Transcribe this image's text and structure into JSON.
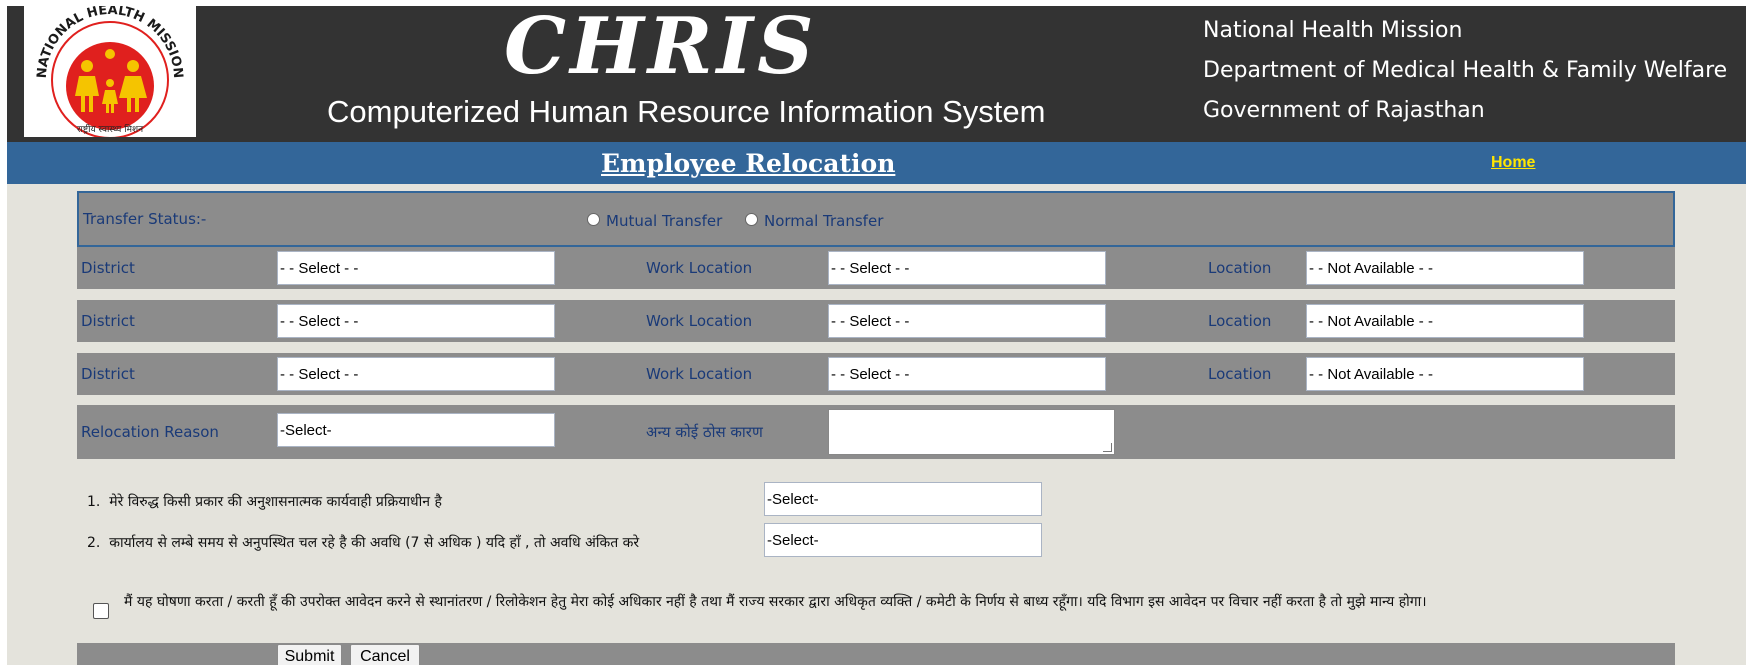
{
  "header": {
    "logo": {
      "arc_text": "NATIONAL HEALTH MISSION",
      "hindi_text": "राष्ट्रीय स्वास्थ्य मिशन",
      "colors": {
        "circle": "#e0201e",
        "figures": "#f5c400"
      }
    },
    "brand": "CHRIS",
    "subtitle": "Computerized Human Resource Information System",
    "org_lines": [
      "National Health Mission",
      "Department of Medical Health & Family Welfare",
      "Government of Rajasthan"
    ]
  },
  "titlebar": {
    "title": "Employee Relocation",
    "home_link": "Home"
  },
  "form": {
    "transfer_status": {
      "label": "Transfer Status:-",
      "options": [
        "Mutual Transfer",
        "Normal Transfer"
      ],
      "selected": null
    },
    "location_rows": [
      {
        "district_label": "District",
        "district_value": "- - Select - -",
        "work_location_label": "Work Location",
        "work_location_value": "- - Select - -",
        "location_label": "Location",
        "location_value": "- - Not Available - -"
      },
      {
        "district_label": "District",
        "district_value": "- - Select - -",
        "work_location_label": "Work Location",
        "work_location_value": "- - Select - -",
        "location_label": "Location",
        "location_value": "- - Not Available - -"
      },
      {
        "district_label": "District",
        "district_value": "- - Select - -",
        "work_location_label": "Work Location",
        "work_location_value": "- - Select - -",
        "location_label": "Location",
        "location_value": "- - Not Available - -"
      }
    ],
    "relocation": {
      "reason_label": "Relocation Reason",
      "reason_value": "-Select-",
      "other_reason_label": "अन्य कोई ठोस कारण",
      "other_reason_value": ""
    },
    "questions": [
      {
        "number": "1.",
        "text": "मेरे विरुद्ध किसी प्रकार की अनुशासनात्मक कार्यवाही प्रक्रियाधीन है",
        "value": "-Select-"
      },
      {
        "number": "2.",
        "text": "कार्यालय से लम्बे समय से अनुपस्थित चल रहे है की अवधि (7 से अधिक ) यदि हाँ , तो अवधि अंकित करे",
        "value": "-Select-"
      }
    ],
    "declaration": "मैं यह घोषणा करता / करती हूँ की उपरोक्त आवेदन करने से स्थानांतरण / रिलोकेशन हेतु मेरा कोई अधिकार नहीं है तथा मैं राज्य सरकार द्वारा अधिकृत व्यक्ति / कमेटी के निर्णय से बाध्य रहूँगा। यदि विभाग इस आवेदन पर विचार नहीं करता है तो मुझे मान्य होगा।",
    "declaration_checked": false,
    "buttons": {
      "submit": "Submit",
      "cancel": "Cancel"
    }
  }
}
